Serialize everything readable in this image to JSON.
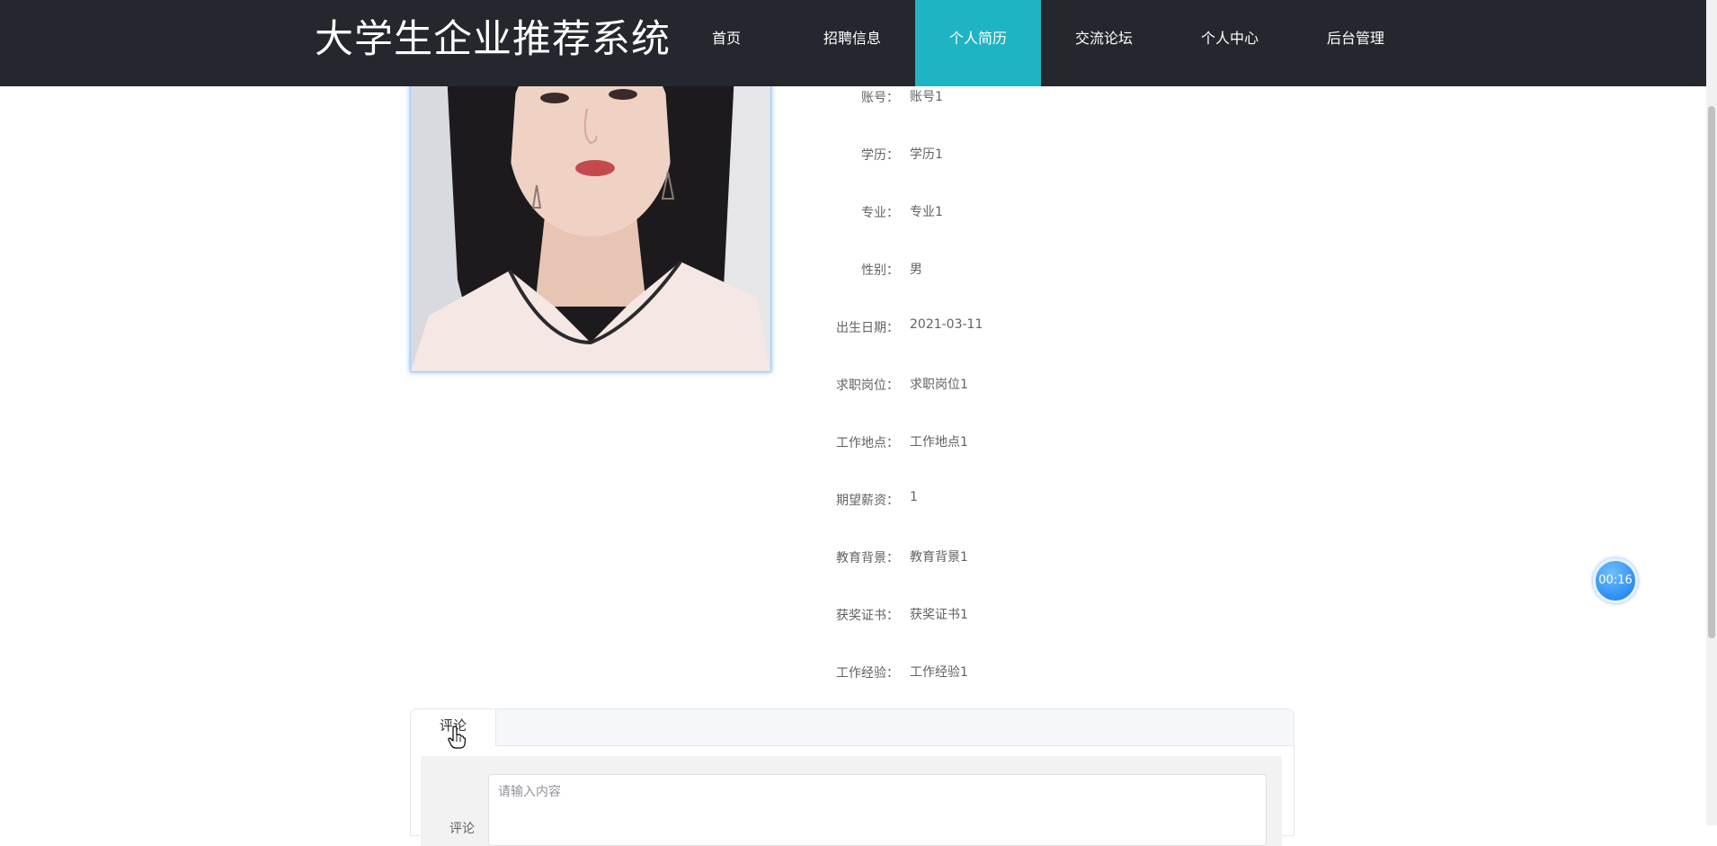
{
  "header": {
    "site_title": "大学生企业推荐系统",
    "nav": [
      {
        "label": "首页"
      },
      {
        "label": "招聘信息"
      },
      {
        "label": "个人简历"
      },
      {
        "label": "交流论坛"
      },
      {
        "label": "个人中心"
      },
      {
        "label": "后台管理"
      }
    ],
    "active_index": 2,
    "colors": {
      "bar": "#24272d",
      "active": "#1fb4c3"
    }
  },
  "resume": {
    "fields": [
      {
        "label": "账号：",
        "value": "账号1"
      },
      {
        "label": "学历：",
        "value": "学历1"
      },
      {
        "label": "专业：",
        "value": "专业1"
      },
      {
        "label": "性别：",
        "value": "男"
      },
      {
        "label": "出生日期：",
        "value": "2021-03-11"
      },
      {
        "label": "求职岗位：",
        "value": "求职岗位1"
      },
      {
        "label": "工作地点：",
        "value": "工作地点1"
      },
      {
        "label": "期望薪资：",
        "value": "1"
      },
      {
        "label": "教育背景：",
        "value": "教育背景1"
      },
      {
        "label": "获奖证书：",
        "value": "获奖证书1"
      },
      {
        "label": "工作经验：",
        "value": "工作经验1"
      }
    ]
  },
  "comments": {
    "tab_label": "评论",
    "field_label": "评论",
    "placeholder": "请输入内容"
  },
  "timer": {
    "text": "00:16"
  }
}
